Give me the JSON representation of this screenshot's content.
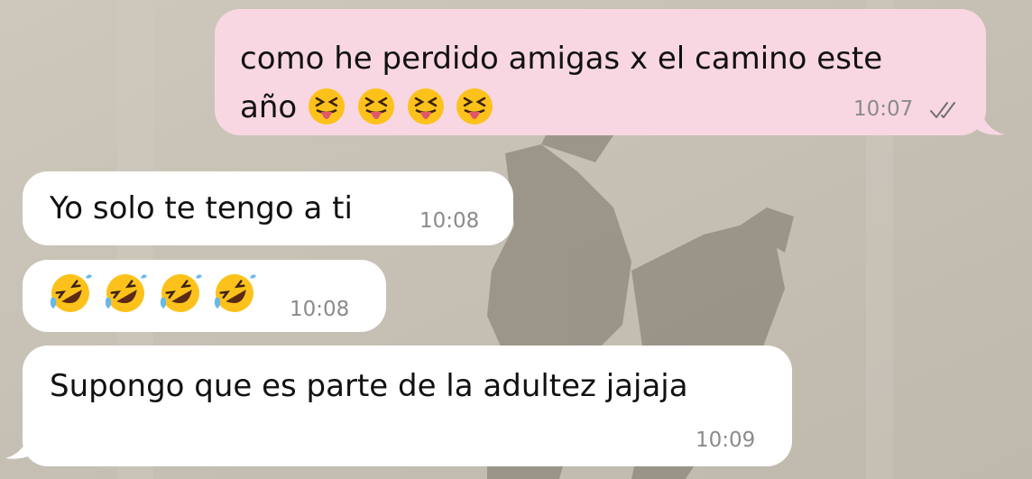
{
  "chat": {
    "messages": [
      {
        "direction": "outgoing",
        "line1": "como he perdido amigas x el camino este",
        "line2": "año",
        "emojis": [
          "squinting-face-with-tongue",
          "squinting-face-with-tongue",
          "squinting-face-with-tongue",
          "squinting-face-with-tongue"
        ],
        "time": "10:07",
        "status_icon": "double-check-read-icon"
      },
      {
        "direction": "incoming",
        "text": "Yo solo te tengo a ti",
        "time": "10:08"
      },
      {
        "direction": "incoming",
        "emojis": [
          "rolling-on-the-floor-laughing",
          "rolling-on-the-floor-laughing",
          "rolling-on-the-floor-laughing",
          "rolling-on-the-floor-laughing"
        ],
        "time": "10:08"
      },
      {
        "direction": "incoming",
        "text": "Supongo que es parte de la adultez jajaja",
        "time": "10:09"
      }
    ]
  },
  "colors": {
    "outgoing_bubble": "#f8d7e3",
    "incoming_bubble": "#ffffff",
    "wallpaper": "#c9c3b8",
    "timestamp": "#8b8b8b",
    "emoji_face": "#fcc21b"
  }
}
